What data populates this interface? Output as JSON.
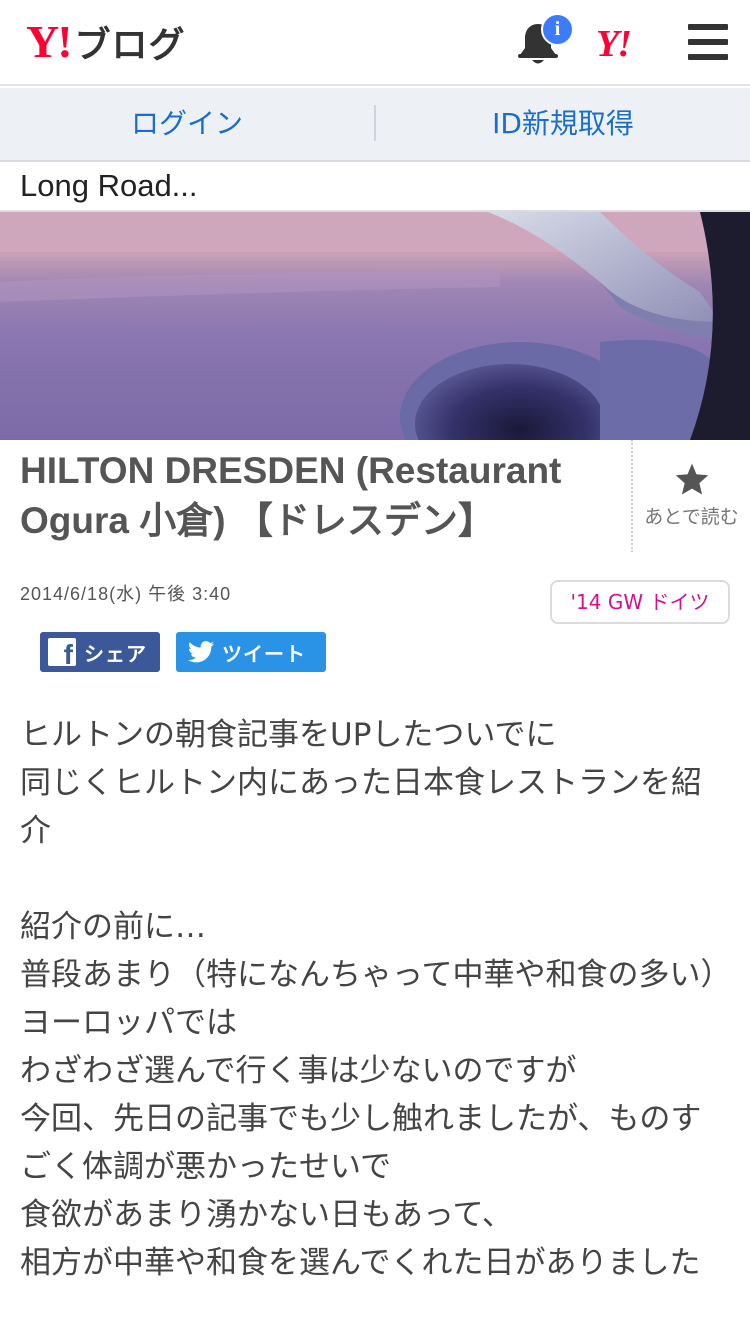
{
  "header": {
    "logo_y": "Y!",
    "logo_text": "ブログ",
    "notification_badge": "i",
    "yahoo_mark": "Y!",
    "icons": [
      "bell-icon",
      "menu-icon"
    ]
  },
  "loginbar": {
    "login": "ログイン",
    "register": "ID新規取得"
  },
  "blog": {
    "title": "Long Road..."
  },
  "article": {
    "title": "HILTON DRESDEN (Restaurant Ogura 小倉) 【ドレスデン】",
    "read_later": "あとで読む",
    "date": "2014/6/18(水) 午後 3:40",
    "tag": "'14 GW ドイツ",
    "share_fb": "シェア",
    "share_tw": "ツイート",
    "body_lines": [
      "ヒルトンの朝食記事をUPしたついでに",
      "同じくヒルトン内にあった日本食レストランを紹介",
      "",
      "紹介の前に…",
      "普段あまり（特になんちゃって中華や和食の多い）ヨーロッパでは",
      "わざわざ選んで行く事は少ないのですが",
      "今回、先日の記事でも少し触れましたが、ものすごく体調が悪かったせいで",
      "食欲があまり湧かない日もあって、",
      "相方が中華や和食を選んでくれた日がありました"
    ]
  },
  "colors": {
    "brand_red": "#ff0033",
    "link_blue": "#1a6ecb",
    "tag_magenta": "#d4108d",
    "facebook": "#3b5998",
    "twitter": "#2b93e6"
  }
}
